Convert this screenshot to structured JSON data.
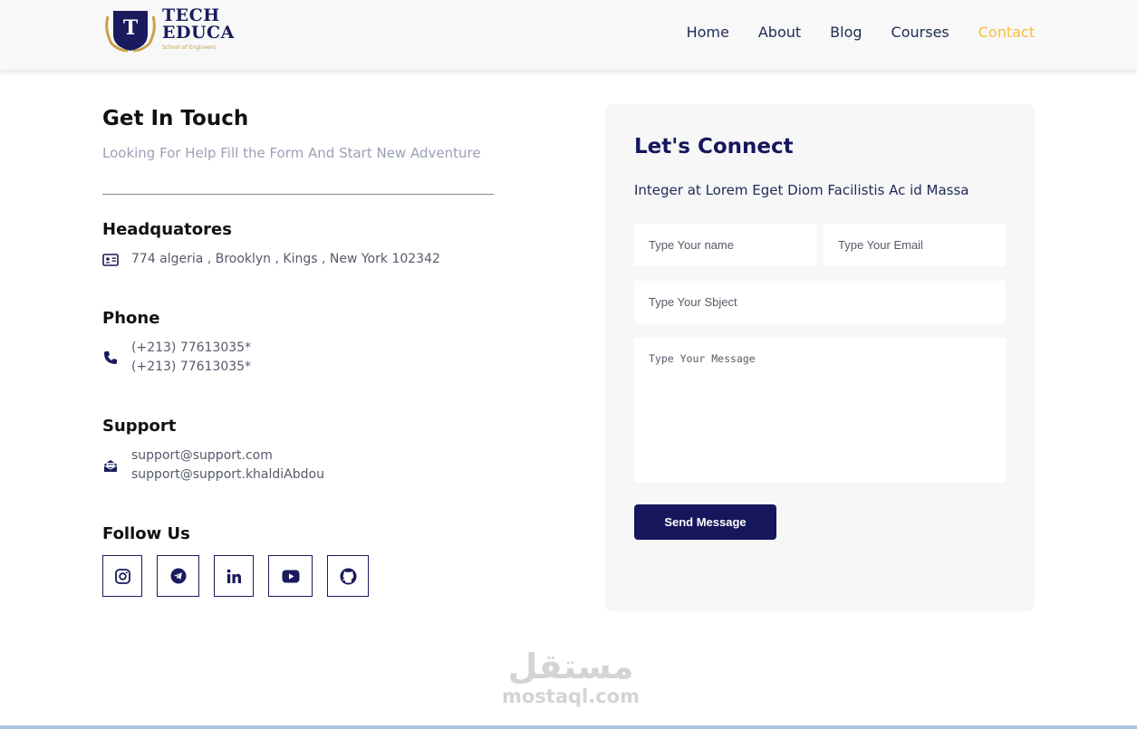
{
  "brand": {
    "logo_letter": "T",
    "line1": "TECH",
    "line2": "EDUCA",
    "tagline": "School of Engineers"
  },
  "nav": {
    "items": [
      "Home",
      "About",
      "Blog",
      "Courses",
      "Contact"
    ],
    "active": "Contact",
    "active_color": "#f5bd3c"
  },
  "contact": {
    "title": "Get In Touch",
    "subtitle": "Looking For Help Fill the Form And Start New Adventure",
    "headquarters": {
      "title": "Headquatores",
      "icon": "id-card-icon",
      "address": "774 algeria , Brooklyn , Kings , New York 102342"
    },
    "phone": {
      "title": "Phone",
      "icon": "phone-icon",
      "lines": [
        "(+213) 77613035*",
        "(+213) 77613035*"
      ]
    },
    "support": {
      "title": "Support",
      "icon": "mail-open-icon",
      "lines": [
        "support@support.com",
        "support@support.khaldiAbdou"
      ]
    },
    "follow": {
      "title": "Follow Us",
      "icons": [
        "instagram-icon",
        "telegram-icon",
        "linkedin-icon",
        "youtube-icon",
        "github-icon"
      ]
    }
  },
  "form": {
    "title": "Let's Connect",
    "subtitle": "Integer at Lorem Eget Diom Facilistis Ac id Massa",
    "name_placeholder": "Type Your name",
    "email_placeholder": "Type Your Email",
    "subject_placeholder": "Type Your Sbject",
    "message_placeholder": "Type Your Message",
    "submit_label": "Send Message",
    "accent_color": "#16165c"
  },
  "watermark": {
    "arabic": "مستقل",
    "latin": "mostaql.com"
  }
}
